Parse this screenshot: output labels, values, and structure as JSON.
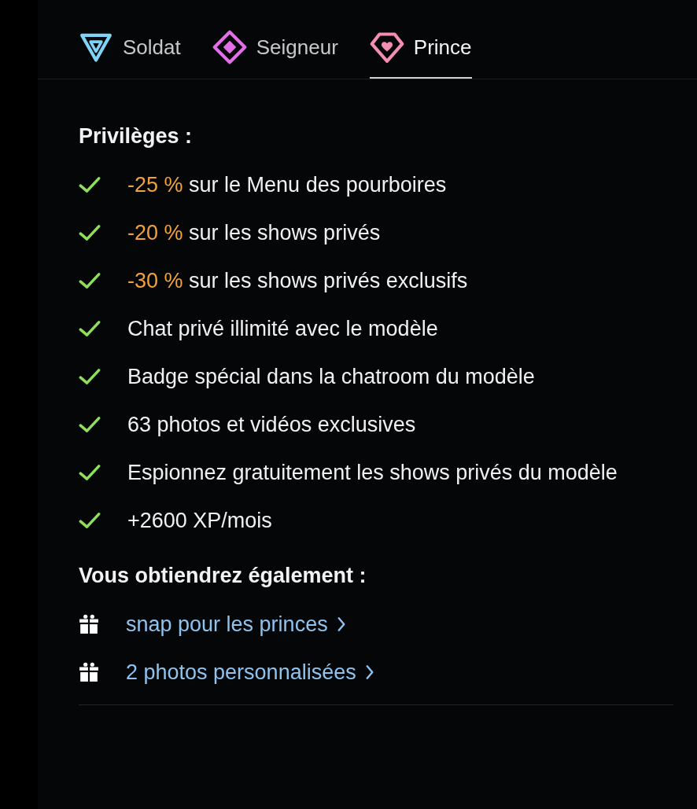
{
  "tabs": [
    {
      "label": "Soldat",
      "kind": "triangle",
      "selected": false
    },
    {
      "label": "Seigneur",
      "kind": "diamond",
      "selected": false
    },
    {
      "label": "Prince",
      "kind": "heart",
      "selected": true
    }
  ],
  "privileges": {
    "heading": "Privilèges :",
    "items": [
      {
        "highlight": "-25 %",
        "text": "sur le Menu des pourboires"
      },
      {
        "highlight": "-20 %",
        "text": "sur les shows privés"
      },
      {
        "highlight": "-30 %",
        "text": "sur les shows privés exclusifs"
      },
      {
        "text": "Chat privé illimité avec le modèle"
      },
      {
        "text": "Badge spécial dans la chatroom du modèle"
      },
      {
        "text": "63 photos et vidéos exclusives"
      },
      {
        "text": "Espionnez gratuitement les shows privés du modèle"
      },
      {
        "text": "+2600 XP/mois"
      }
    ]
  },
  "bonuses": {
    "heading": "Vous obtiendrez également :",
    "items": [
      {
        "label": "snap pour les princes"
      },
      {
        "label": "2 photos personnalisées"
      }
    ]
  }
}
